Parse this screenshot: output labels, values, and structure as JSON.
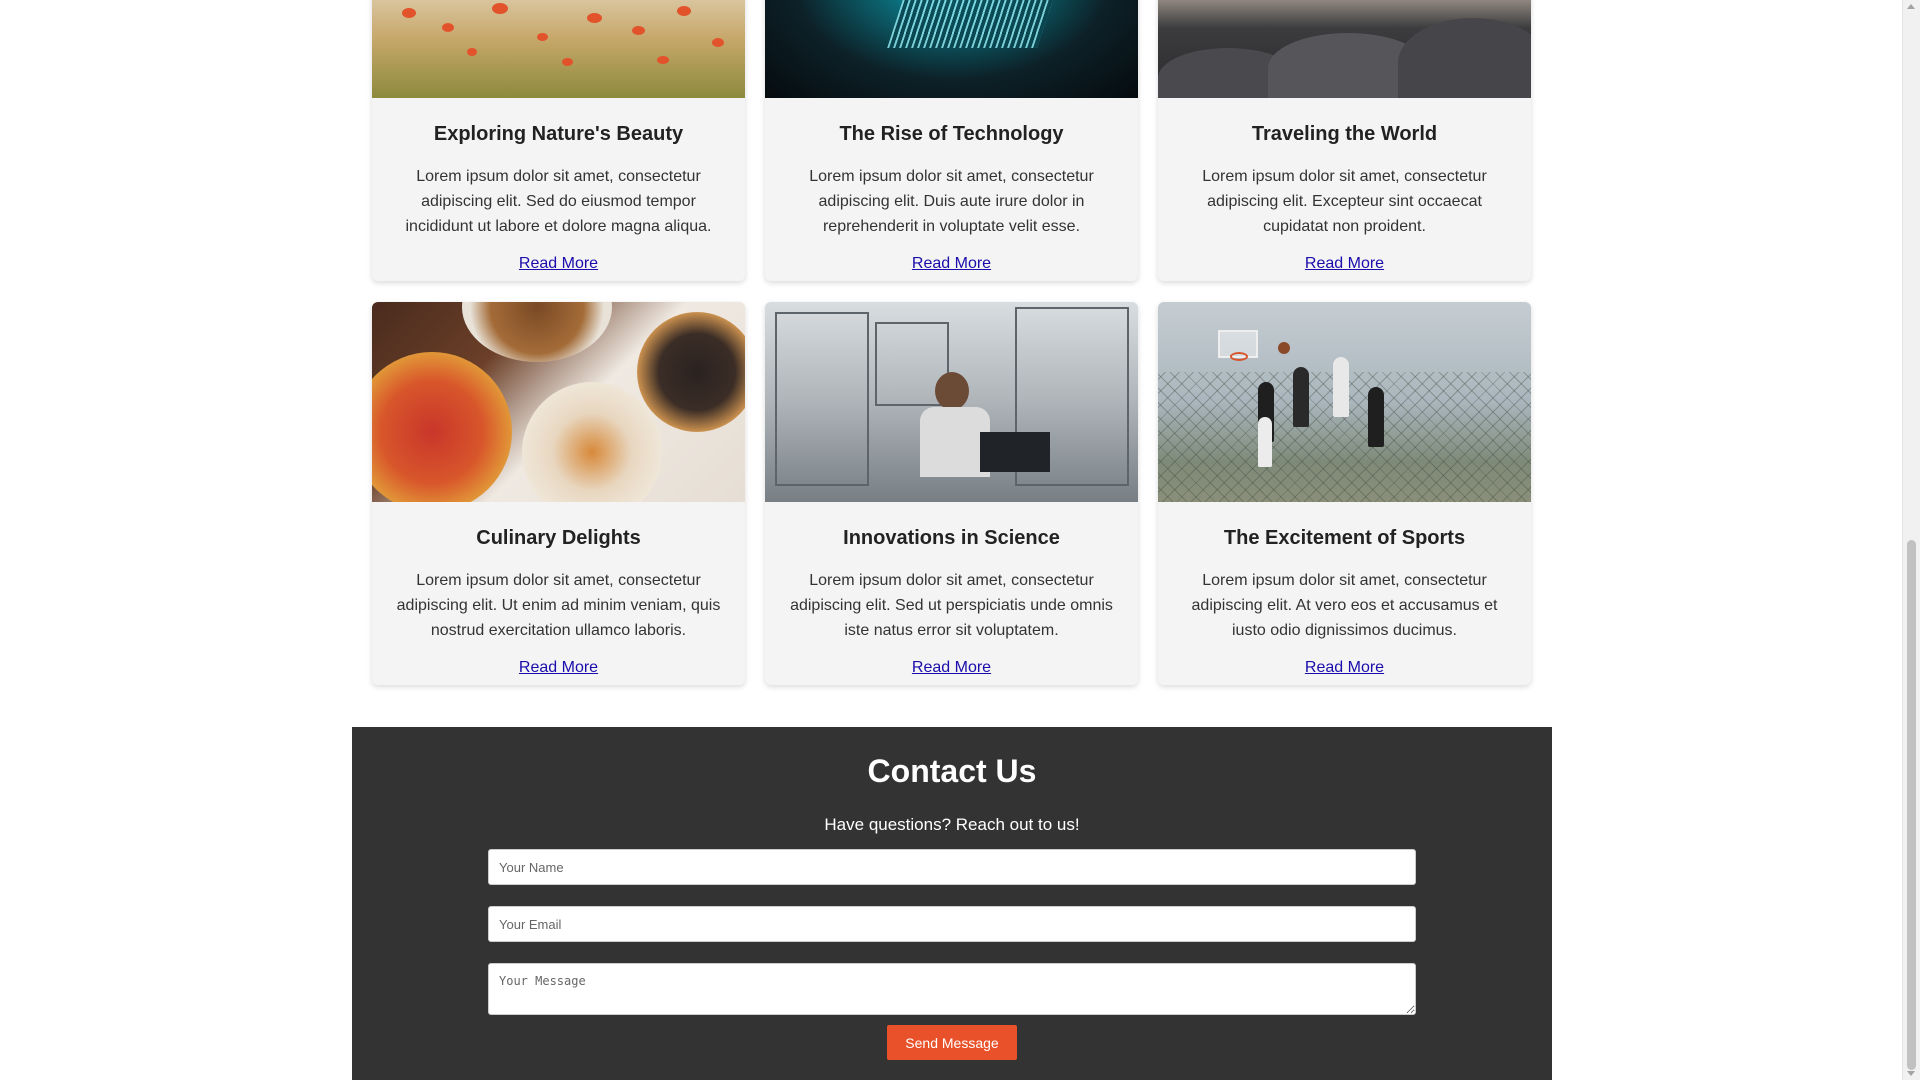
{
  "cards": [
    {
      "title": "Exploring Nature's Beauty",
      "text": "Lorem ipsum dolor sit amet, consectetur adipiscing elit. Sed do eiusmod tempor incididunt ut labore et dolore magna aliqua.",
      "link": "Read More",
      "image": "poppy-field-photo"
    },
    {
      "title": "The Rise of Technology",
      "text": "Lorem ipsum dolor sit amet, consectetur adipiscing elit. Duis aute irure dolor in reprehenderit in voluptate velit esse.",
      "link": "Read More",
      "image": "microchip-photo"
    },
    {
      "title": "Traveling the World",
      "text": "Lorem ipsum dolor sit amet, consectetur adipiscing elit. Excepteur sint occaecat cupidatat non proident.",
      "link": "Read More",
      "image": "coastal-rocks-photo"
    },
    {
      "title": "Culinary Delights",
      "text": "Lorem ipsum dolor sit amet, consectetur adipiscing elit. Ut enim ad minim veniam, quis nostrud exercitation ullamco laboris.",
      "link": "Read More",
      "image": "food-table-photo"
    },
    {
      "title": "Innovations in Science",
      "text": "Lorem ipsum dolor sit amet, consectetur adipiscing elit. Sed ut perspiciatis unde omnis iste natus error sit voluptatem.",
      "link": "Read More",
      "image": "science-lab-photo"
    },
    {
      "title": "The Excitement of Sports",
      "text": "Lorem ipsum dolor sit amet, consectetur adipiscing elit. At vero eos et accusamus et iusto odio dignissimos ducimus.",
      "link": "Read More",
      "image": "basketball-photo"
    }
  ],
  "contact": {
    "title": "Contact Us",
    "subtitle": "Have questions? Reach out to us!",
    "name_placeholder": "Your Name",
    "email_placeholder": "Your Email",
    "message_placeholder": "Your Message",
    "name_value": "",
    "email_value": "",
    "message_value": "",
    "send_label": "Send Message"
  },
  "colors": {
    "contact_bg": "#333333",
    "button_bg": "#e8512a",
    "link": "#1a0dab",
    "card_bg": "#f4f4f4"
  }
}
